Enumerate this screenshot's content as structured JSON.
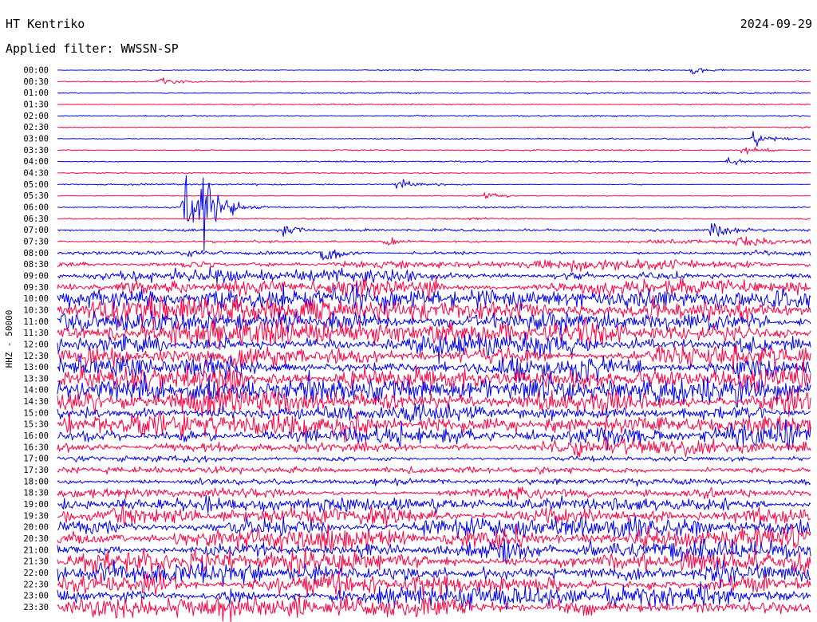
{
  "header": {
    "station": "HT Kentriko",
    "date": "2024-09-29",
    "filter": "Applied filter: WWSSN-SP",
    "channel_label": "HHZ - 50000"
  },
  "colors": {
    "trace_a": "#0000ee",
    "trace_b": "#ff0040",
    "text": "#000000"
  },
  "chart_data": {
    "type": "line",
    "title": "HT Kentriko",
    "subtitle": "Applied filter: WWSSN-SP",
    "ylabel": "HHZ - 50000",
    "xlabel": "",
    "grid": false,
    "legend": "none",
    "rows": [
      "00:00",
      "00:30",
      "01:00",
      "01:30",
      "02:00",
      "02:30",
      "03:00",
      "03:30",
      "04:00",
      "04:30",
      "05:00",
      "05:30",
      "06:00",
      "06:30",
      "07:00",
      "07:30",
      "08:00",
      "08:30",
      "09:00",
      "09:30",
      "10:00",
      "10:30",
      "11:00",
      "11:30",
      "12:00",
      "12:30",
      "13:00",
      "13:30",
      "14:00",
      "14:30",
      "15:00",
      "15:30",
      "16:00",
      "16:30",
      "17:00",
      "17:30",
      "18:00",
      "18:30",
      "19:00",
      "19:30",
      "20:00",
      "20:30",
      "21:00",
      "21:30",
      "22:00",
      "22:30",
      "23:00",
      "23:30"
    ],
    "row_colors": [
      "#0000ee",
      "#ff0040"
    ],
    "noise_level": [
      0.4,
      0.4,
      0.4,
      0.35,
      0.35,
      0.35,
      0.35,
      0.35,
      0.35,
      0.35,
      0.4,
      0.4,
      0.45,
      0.5,
      0.7,
      1.0,
      1.3,
      2.5,
      3.5,
      4,
      5,
      6,
      6.5,
      6.5,
      6.5,
      6.5,
      6.5,
      6.5,
      6.5,
      6.5,
      6.5,
      6.5,
      6,
      4,
      2,
      1.5,
      1.5,
      2.5,
      3.5,
      4.5,
      5,
      5.5,
      5.5,
      5.5,
      5.5,
      5.5,
      5.5,
      5.5
    ],
    "events": [
      {
        "row": 0,
        "minute": 25.3,
        "amplitude": 4
      },
      {
        "row": 1,
        "minute": 4.0,
        "amplitude": 4
      },
      {
        "row": 6,
        "minute": 27.7,
        "amplitude": 9
      },
      {
        "row": 7,
        "minute": 27.3,
        "amplitude": 7
      },
      {
        "row": 8,
        "minute": 26.7,
        "amplitude": 4
      },
      {
        "row": 10,
        "minute": 13.5,
        "amplitude": 4
      },
      {
        "row": 11,
        "minute": 17.0,
        "amplitude": 4
      },
      {
        "row": 12,
        "minute": 5.0,
        "amplitude": 44
      },
      {
        "row": 12,
        "minute": 5.8,
        "amplitude": 44
      },
      {
        "row": 14,
        "minute": 9.0,
        "amplitude": 6
      },
      {
        "row": 14,
        "minute": 26.0,
        "amplitude": 7
      },
      {
        "row": 15,
        "minute": 13.0,
        "amplitude": 9
      },
      {
        "row": 15,
        "minute": 27.0,
        "amplitude": 9
      },
      {
        "row": 16,
        "minute": 10.5,
        "amplitude": 11
      }
    ]
  }
}
